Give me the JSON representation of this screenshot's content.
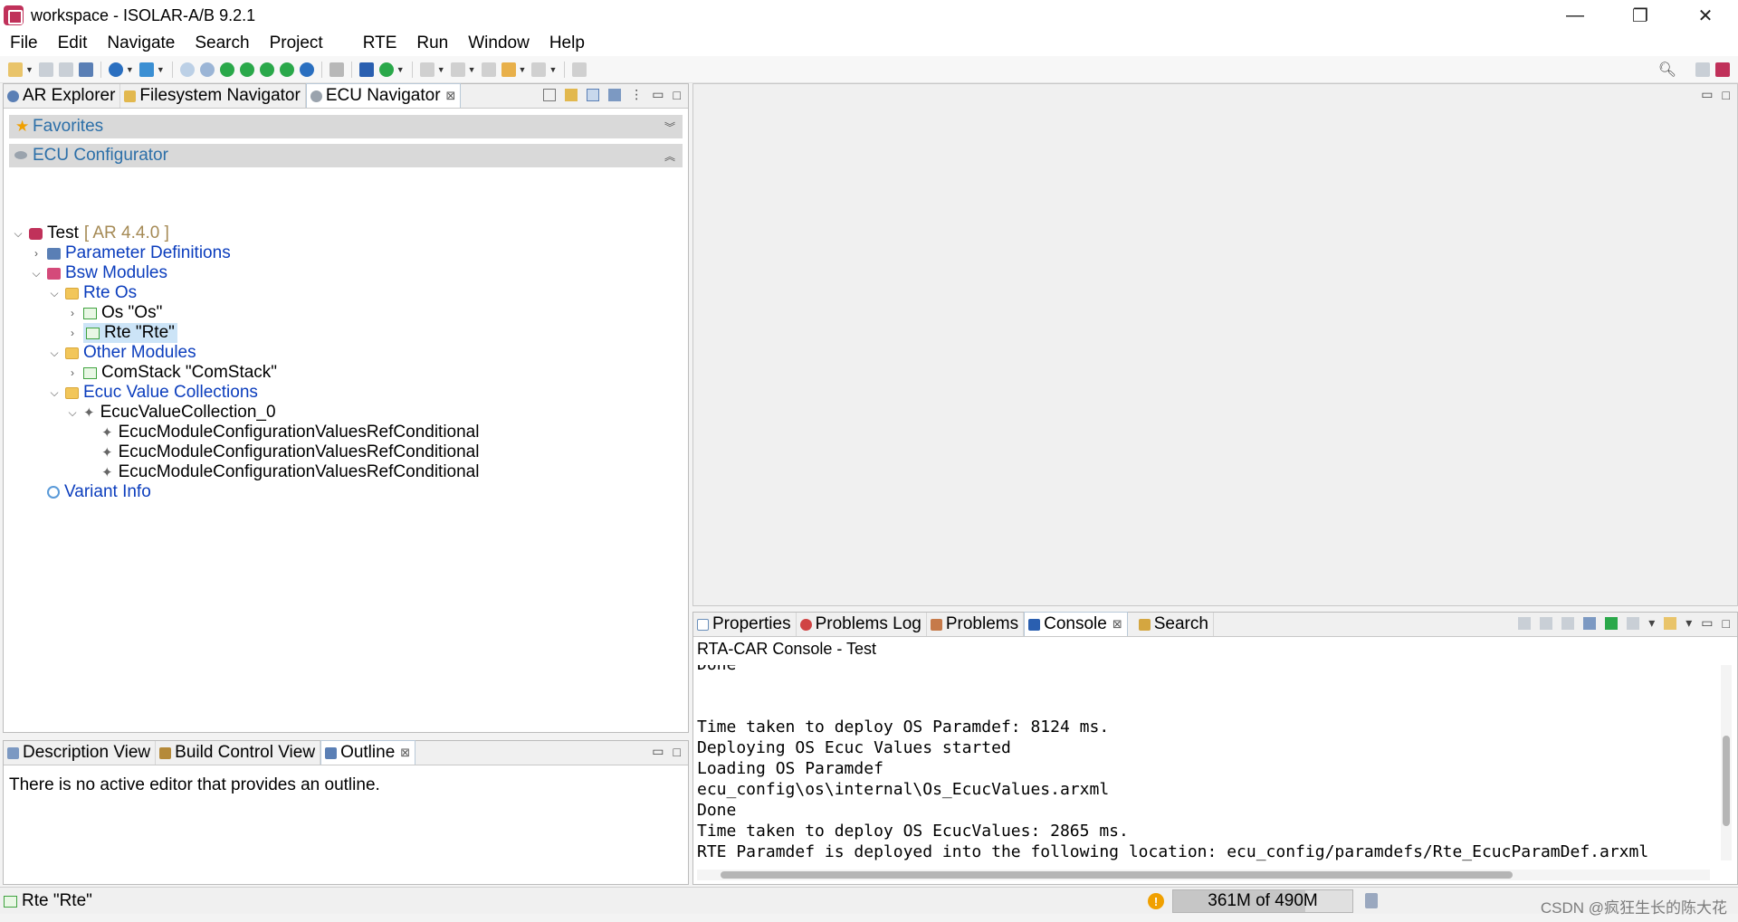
{
  "window": {
    "title": "workspace - ISOLAR-A/B 9.2.1",
    "controls": {
      "minimize": "—",
      "maximize": "❐",
      "close": "✕"
    }
  },
  "menu": [
    "File",
    "Edit",
    "Navigate",
    "Search",
    "Project",
    "RTE",
    "Run",
    "Window",
    "Help"
  ],
  "left_panel": {
    "tabs": [
      {
        "label": "AR Explorer",
        "icon": "ar-explorer-icon"
      },
      {
        "label": "Filesystem Navigator",
        "icon": "filesystem-icon"
      },
      {
        "label": "ECU Navigator",
        "icon": "ecu-navigator-icon",
        "active": true,
        "close": "⊠"
      }
    ],
    "favorites": "Favorites",
    "ecu_configurator": "ECU Configurator",
    "tree": {
      "root": {
        "label": "Test",
        "version": "[ AR 4.4.0 ]"
      },
      "parameter_definitions": "Parameter Definitions",
      "bsw_modules": "Bsw Modules",
      "rte_os": "Rte Os",
      "os": "Os \"Os\"",
      "rte": "Rte \"Rte\"",
      "other_modules": "Other Modules",
      "comstack": "ComStack \"ComStack\"",
      "ecuc_value_collections": "Ecuc Value Collections",
      "ecuc_value_collection_0": "EcucValueCollection_0",
      "refs": [
        "EcucModuleConfigurationValuesRefConditional",
        "EcucModuleConfigurationValuesRefConditional",
        "EcucModuleConfigurationValuesRefConditional"
      ],
      "variant_info": "Variant Info"
    }
  },
  "outline_panel": {
    "tabs": [
      {
        "label": "Description View",
        "icon": "description-view-icon"
      },
      {
        "label": "Build Control View",
        "icon": "build-control-icon"
      },
      {
        "label": "Outline",
        "icon": "outline-icon",
        "active": true,
        "close": "⊠"
      }
    ],
    "message": "There is no active editor that provides an outline."
  },
  "console_panel": {
    "tabs": [
      {
        "label": "Properties",
        "icon": "properties-icon"
      },
      {
        "label": "Problems Log",
        "icon": "problems-log-icon"
      },
      {
        "label": "Problems",
        "icon": "problems-icon"
      },
      {
        "label": "Console",
        "icon": "console-icon",
        "active": true,
        "close": "⊠"
      },
      {
        "label": "Search",
        "icon": "search-icon"
      }
    ],
    "title": "RTA-CAR Console - Test",
    "lines": [
      "Done",
      "",
      "",
      "Time taken to deploy OS Paramdef: 8124 ms.",
      "Deploying OS Ecuc Values started",
      "Loading OS Paramdef",
      "ecu_config\\os\\internal\\Os_EcucValues.arxml",
      "Done",
      "Time taken to deploy OS EcucValues: 2865 ms.",
      "RTE Paramdef is deployed into the following location: ecu_config/paramdefs/Rte_EcucParamDef.arxml"
    ]
  },
  "status": {
    "selection": "Rte \"Rte\"",
    "heap": "361M of 490M",
    "heap_fraction": 0.737,
    "watermark": "CSDN @疯狂生长的陈大花"
  },
  "colors": {
    "tree_link": "#0b3dbd",
    "version": "#a58a55",
    "section_header_text": "#2c6fa8",
    "selection": "#cce4f7"
  }
}
